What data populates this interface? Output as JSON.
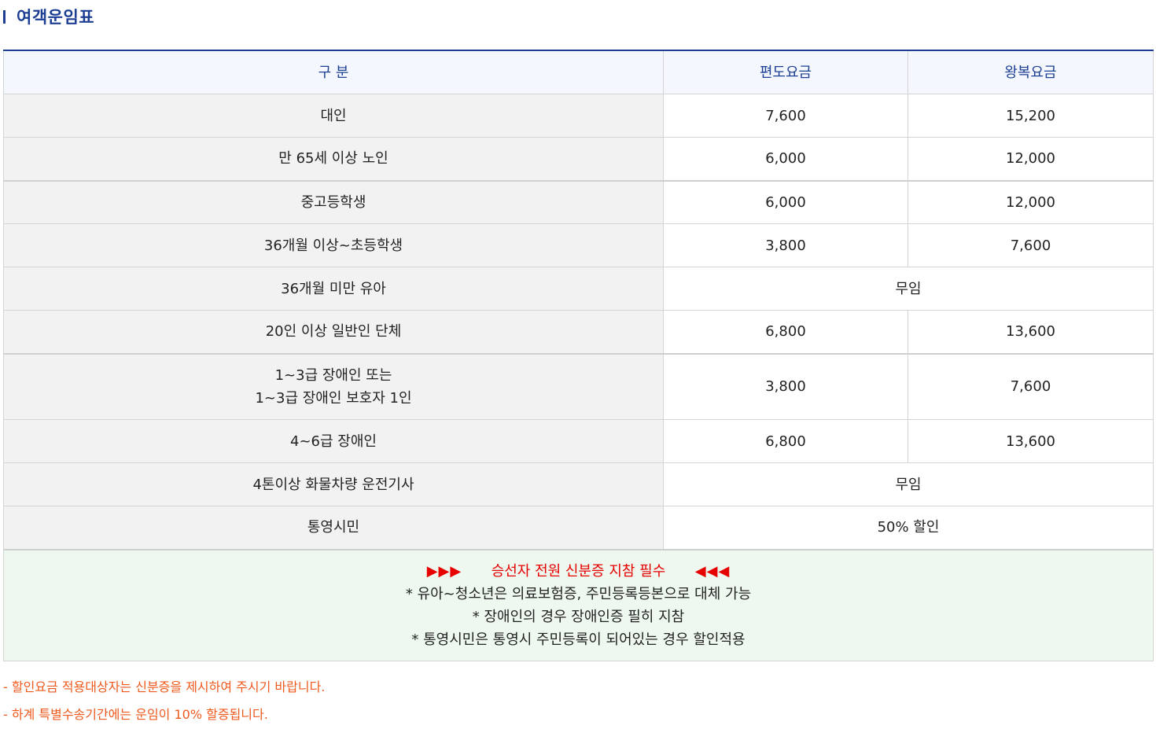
{
  "title": "여객운임표",
  "table": {
    "headers": [
      "구 분",
      "편도요금",
      "왕복요금"
    ],
    "rows": [
      {
        "label": "대인",
        "oneway": "7,600",
        "round": "15,200"
      },
      {
        "label": "만 65세 이상 노인",
        "oneway": "6,000",
        "round": "12,000"
      },
      {
        "label": "중고등학생",
        "oneway": "6,000",
        "round": "12,000"
      },
      {
        "label": "36개월 이상~초등학생",
        "oneway": "3,800",
        "round": "7,600"
      },
      {
        "label": "36개월 미만 유아",
        "merged": "무임"
      },
      {
        "label": "20인 이상 일반인 단체",
        "oneway": "6,800",
        "round": "13,600"
      },
      {
        "label_lines": [
          "1~3급 장애인 또는",
          "1~3급 장애인 보호자 1인"
        ],
        "oneway": "3,800",
        "round": "7,600"
      },
      {
        "label": "4~6급 장애인",
        "oneway": "6,800",
        "round": "13,600"
      },
      {
        "label": "4톤이상 화물차량 운전기사",
        "merged": "무임"
      },
      {
        "label": "통영시민",
        "merged": "50% 할인"
      }
    ]
  },
  "notice": {
    "arrows_left": "▶▶▶",
    "headline": "승선자 전원 신분증 지참 필수",
    "arrows_right": "◀◀◀",
    "lines": [
      "* 유아~청소년은 의료보험증, 주민등록등본으로 대체 가능",
      "* 장애인의 경우 장애인증 필히 지참",
      "* 통영시민은 통영시 주민등록이 되어있는 경우 할인적용"
    ]
  },
  "footnotes": [
    "- 할인요금 적용대상자는 신분증을 제시하여 주시기 바랍니다.",
    "- 하계 특별수송기간에는 운임이 10% 할증됩니다."
  ],
  "colors": {
    "title": "#1c3f94",
    "notice_red": "#e60000",
    "footnote_orange": "#ee5a1e",
    "notice_bg": "#eef8ef",
    "header_bg": "#f4f7fd",
    "label_bg": "#f2f2f2"
  }
}
